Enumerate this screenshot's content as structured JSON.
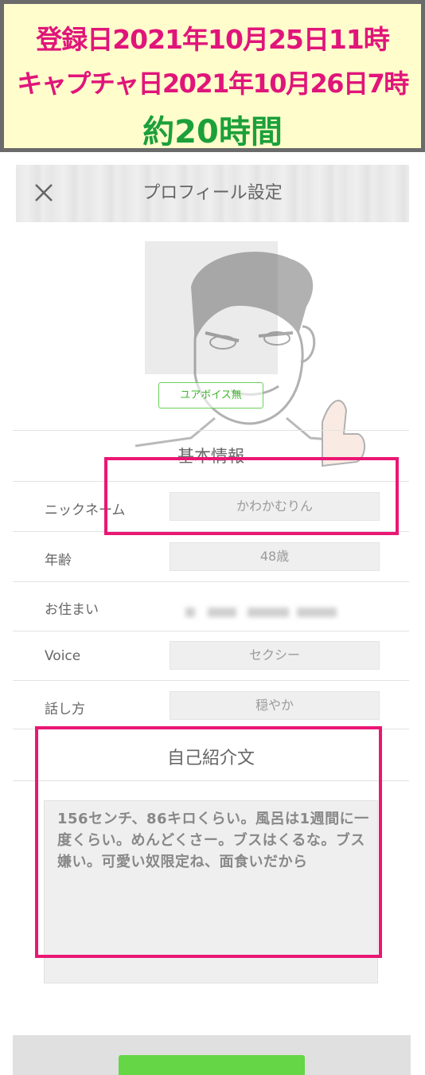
{
  "banner": {
    "registered": "登録日2021年10月25日11時",
    "captured": "キャプチャ日2021年10月26日7時",
    "elapsed": "約20時間"
  },
  "header": {
    "title": "プロフィール設定"
  },
  "profile": {
    "voice_badge": "ユアボイス無"
  },
  "basic_info": {
    "title": "基本情報",
    "rows": [
      {
        "label": "ニックネーム",
        "value": "かわかむりん"
      },
      {
        "label": "年齢",
        "value": "48歳"
      },
      {
        "label": "お住まい",
        "value": ""
      },
      {
        "label": "Voice",
        "value": "セクシー"
      },
      {
        "label": "話し方",
        "value": "穏やか"
      }
    ]
  },
  "intro": {
    "title": "自己紹介文",
    "text": "156センチ、86キロくらい。風呂は1週間に一度くらい。めんどくさー。ブスはくるな。ブス嫌い。可愛い奴限定ね、面食いだから"
  },
  "colors": {
    "highlight": "#ea1774",
    "banner_pink": "#e0157a",
    "banner_green": "#1ca03a",
    "accent_green": "#65d645"
  }
}
